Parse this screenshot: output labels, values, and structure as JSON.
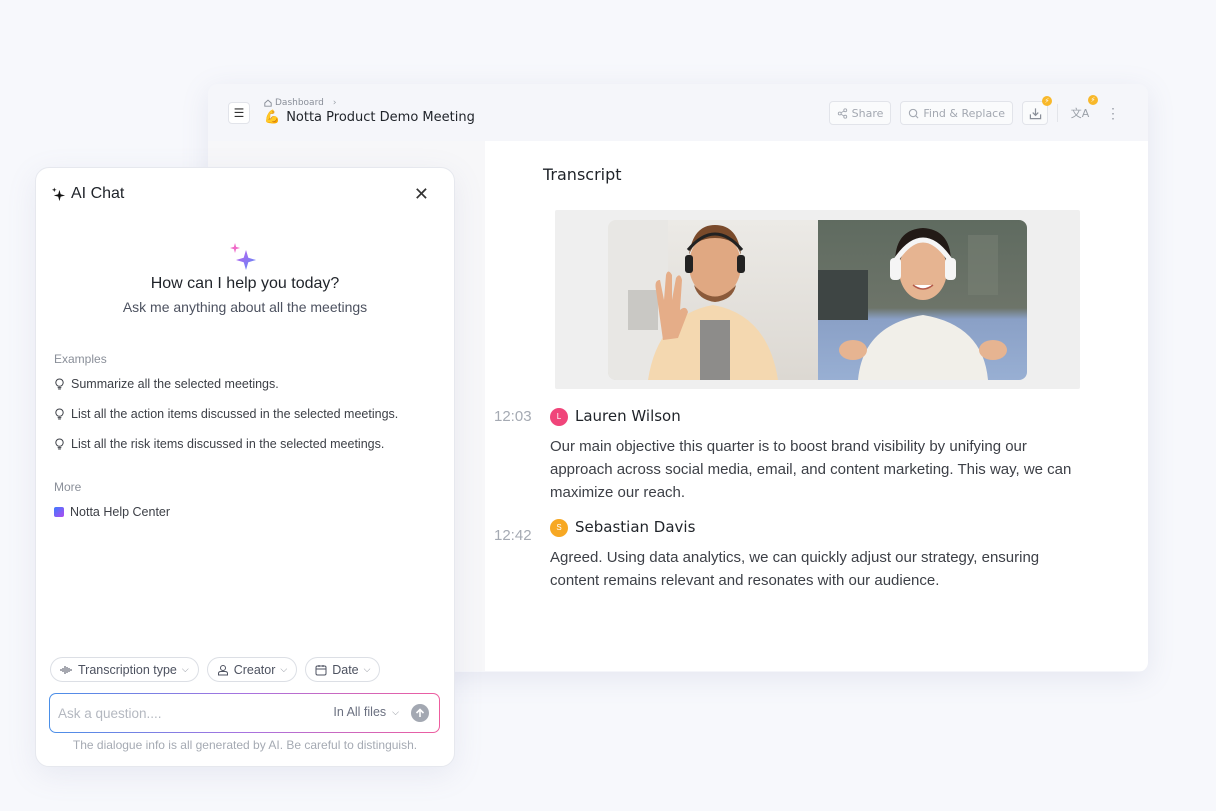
{
  "window": {
    "breadcrumb": {
      "home_label": "Dashboard"
    },
    "title": {
      "emoji": "💪",
      "text": "Notta Product Demo Meeting"
    },
    "actions": {
      "share_label": "Share",
      "find_replace_label": "Find & Replace",
      "download_badge": "⚡",
      "translate_badge": "⚡"
    }
  },
  "transcript": {
    "heading": "Transcript",
    "entries": [
      {
        "time": "12:03",
        "initial": "L",
        "speaker": "Lauren Wilson",
        "avatar_color": "#f0457a",
        "text": "Our main objective this quarter is to boost brand visibility by unifying our approach across social media, email, and content marketing. This way, we can maximize our reach."
      },
      {
        "time": "12:42",
        "initial": "S",
        "speaker": "Sebastian Davis",
        "avatar_color": "#f7a823",
        "text": "Agreed. Using data analytics, we can quickly adjust our strategy, ensuring content remains relevant and resonates with our audience."
      }
    ]
  },
  "chat": {
    "title": "AI Chat",
    "hero_title": "How can I help you today?",
    "hero_subtitle": "Ask me anything about all the meetings",
    "examples_label": "Examples",
    "examples": [
      "Summarize all the selected meetings.",
      "List all the action items discussed in the selected meetings.",
      "List all the risk items discussed in the selected meetings."
    ],
    "more_label": "More",
    "more_links": [
      "Notta Help Center"
    ],
    "filters": [
      "Transcription type",
      "Creator",
      "Date"
    ],
    "input": {
      "placeholder": "Ask a question....",
      "value": ""
    },
    "scope_label": "In All files",
    "disclaimer": "The dialogue info is all generated by AI. Be careful to distinguish."
  },
  "colors": {
    "gradient_start": "#4a8fe8",
    "gradient_mid": "#a773e0",
    "gradient_end": "#ee5d9f",
    "badge": "#f8b82a"
  }
}
